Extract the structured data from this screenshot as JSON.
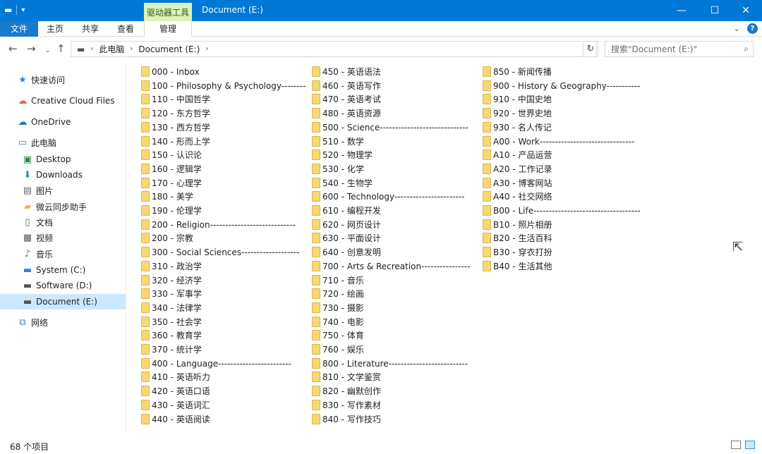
{
  "window": {
    "context_tab": "驱动器工具",
    "title": "Document (E:)",
    "minimize_icon": "—",
    "maximize_icon": "☐",
    "close_icon": "✕"
  },
  "ribbon": {
    "tabs": [
      "文件",
      "主页",
      "共享",
      "查看"
    ],
    "context_tab": "管理"
  },
  "address": {
    "path": [
      "此电脑",
      "Document (E:)"
    ],
    "search_placeholder": "搜索\"Document (E:)\""
  },
  "sidebar": {
    "quick_access": "快速访问",
    "creative_cloud": "Creative Cloud Files",
    "onedrive": "OneDrive",
    "this_pc": "此电脑",
    "pc_items": [
      "Desktop",
      "Downloads",
      "图片",
      "微云同步助手",
      "文档",
      "视频",
      "音乐",
      "System (C:)",
      "Software (D:)",
      "Document (E:)"
    ],
    "network": "网络"
  },
  "folders": {
    "col1": [
      "000 - Inbox",
      "100 - Philosophy & Psychology--------",
      "110 - 中国哲学",
      "120 - 东方哲学",
      "130 - 西方哲学",
      "140 - 形而上学",
      "150 - 认识论",
      "160 - 逻辑学",
      "170 - 心理学",
      "180 - 美学",
      "190 - 伦理学",
      "200 - Religion----------------------------",
      "200 - 宗教",
      "300 - Social Sciences-------------------",
      "310 - 政治学",
      "320 - 经济学",
      "330 - 军事学",
      "340 - 法律学",
      "350 - 社会学",
      "360 - 教育学",
      "370 - 统计学",
      "400 - Language------------------------",
      "410 - 英语听力",
      "420 - 英语口语",
      "430 - 英语词汇",
      "440 - 英语阅读"
    ],
    "col2": [
      "450 - 英语语法",
      "460 - 英语写作",
      "470 - 英语考试",
      "480 - 英语资源",
      "500 - Science-----------------------------",
      "510 - 数学",
      "520 - 物理学",
      "530 - 化学",
      "540 - 生物学",
      "600 - Technology-----------------------",
      "610 - 编程开发",
      "620 - 网页设计",
      "630 - 平面设计",
      "640 - 创意发明",
      "700 - Arts & Recreation----------------",
      "710 - 音乐",
      "720 - 绘画",
      "730 - 摄影",
      "740 - 电影",
      "750 - 体育",
      "760 - 娱乐",
      "800 - Literature--------------------------",
      "810 - 文学鉴赏",
      "820 - 幽默创作",
      "830 - 写作素材",
      "840 - 写作技巧"
    ],
    "col3": [
      "850 - 新闻传播",
      "900 - History & Geography-----------",
      "910 - 中国史地",
      "920 - 世界史地",
      "930 - 名人传记",
      "A00 - Work-------------------------------",
      "A10 - 产品运营",
      "A20 - 工作记录",
      "A30 - 博客网站",
      "A40 - 社交网络",
      "B00 - Life-----------------------------------",
      "B10 - 照片相册",
      "B20 - 生活百科",
      "B30 - 穿衣打扮",
      "B40 - 生活其他"
    ]
  },
  "status": {
    "count": "68 个项目"
  }
}
